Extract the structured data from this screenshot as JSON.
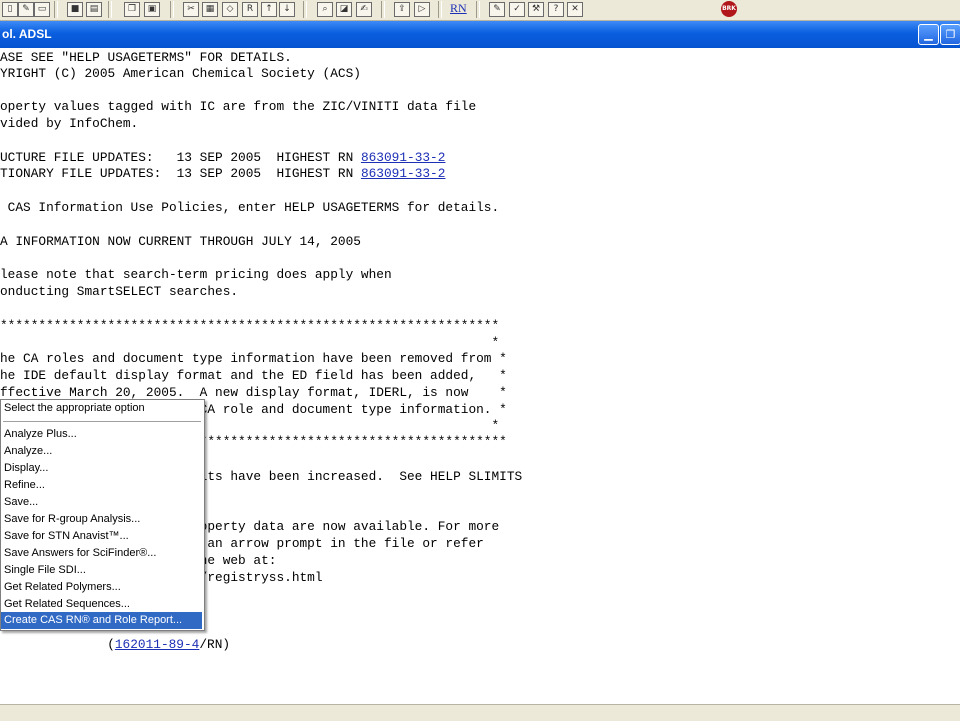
{
  "toolbar": {
    "rn_label": "RN",
    "brk_label": "BRK"
  },
  "window": {
    "title": "ol. ADSL"
  },
  "content": {
    "lines": [
      "ASE SEE \"HELP USAGETERMS\" FOR DETAILS.",
      "YRIGHT (C) 2005 American Chemical Society (ACS)",
      "operty values tagged with IC are from the ZIC/VINITI data file",
      "vided by InfoChem.",
      "UCTURE FILE UPDATES:   13 SEP 2005  HIGHEST RN ",
      "TIONARY FILE UPDATES:  13 SEP 2005  HIGHEST RN ",
      " CAS Information Use Policies, enter HELP USAGETERMS for details.",
      "A INFORMATION NOW CURRENT THROUGH JULY 14, 2005",
      "lease note that search-term pricing does apply when",
      "onducting SmartSELECT searches.",
      "*****************************************************************",
      "                                                                *",
      "he CA roles and document type information have been removed from *",
      "he IDE default display format and the ED field has been added,   *",
      "ffective March 20, 2005.  A new display format, IDERL, is now    *",
      "                          CA role and document type information. *",
      "                                                                *",
      "                         *****************************************",
      "                         mits have been increased.  See HELP SLIMITS",
      "                         roperty data are now available. For more",
      "                         t an arrow prompt in the file or refer",
      "                         the web at:",
      "                         S/registryss.html",
      "               (",
      "/RN)"
    ],
    "highest_rn": "863091-33-2",
    "rn_link": "162011-89-4"
  },
  "menu": {
    "header": "Select the appropriate option",
    "items": [
      "Analyze Plus...",
      "Analyze...",
      "Display...",
      "Refine...",
      "Save...",
      "Save for R-group Analysis...",
      "Save for STN Anavist™...",
      "Save Answers for SciFinder®...",
      "Single File SDI...",
      "Get Related Polymers...",
      "Get Related Sequences...",
      "Create CAS RN® and Role Report..."
    ],
    "highlighted_index": 11
  }
}
